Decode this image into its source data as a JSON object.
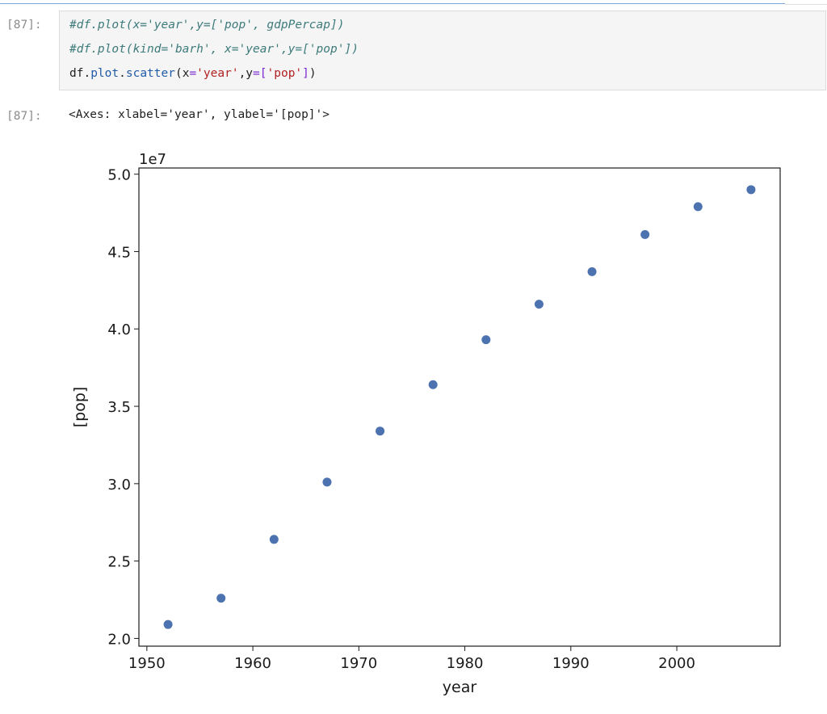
{
  "cell": {
    "input_prompt": "[87]:",
    "output_prompt": "[87]:",
    "code": {
      "line1": "#df.plot(x='year',y=['pop', gdpPercap])",
      "line2": "#df.plot(kind='barh', x='year',y=['pop'])",
      "line3": {
        "obj": "df",
        "dot1": ".",
        "method1": "plot",
        "dot2": ".",
        "method2": "scatter",
        "open": "(",
        "arg1": "x",
        "eq1": "=",
        "val1": "'year'",
        "comma": ",",
        "arg2": "y",
        "eq2": "=",
        "bracket_open": "[",
        "val2": "'pop'",
        "bracket_close": "]",
        "close": ")"
      }
    },
    "output_text": "<Axes: xlabel='year', ylabel='[pop]'>"
  },
  "colors": {
    "marker": "#4c72b0",
    "comment": "#3d7a7a",
    "string": "#b22222",
    "attribute": "#1f5ba8",
    "operator": "#7a2ad1"
  },
  "chart_data": {
    "type": "scatter",
    "title": "",
    "xlabel": "year",
    "ylabel": "[pop]",
    "y_offset_label": "1e7",
    "xlim": [
      1949.25,
      2009.75
    ],
    "ylim": [
      1.95,
      5.04
    ],
    "xticks": [
      1950,
      1960,
      1970,
      1980,
      1990,
      2000
    ],
    "xtick_labels": [
      "1950",
      "1960",
      "1970",
      "1980",
      "1990",
      "2000"
    ],
    "yticks": [
      2.0,
      2.5,
      3.0,
      3.5,
      4.0,
      4.5,
      5.0
    ],
    "ytick_labels": [
      "2.0",
      "2.5",
      "3.0",
      "3.5",
      "4.0",
      "4.5",
      "5.0"
    ],
    "grid": false,
    "x": [
      1952,
      1957,
      1962,
      1967,
      1972,
      1977,
      1982,
      1987,
      1992,
      1997,
      2002,
      2007
    ],
    "y": [
      2.09,
      2.26,
      2.64,
      3.01,
      3.34,
      3.64,
      3.93,
      4.16,
      4.37,
      4.61,
      4.79,
      4.9
    ]
  }
}
